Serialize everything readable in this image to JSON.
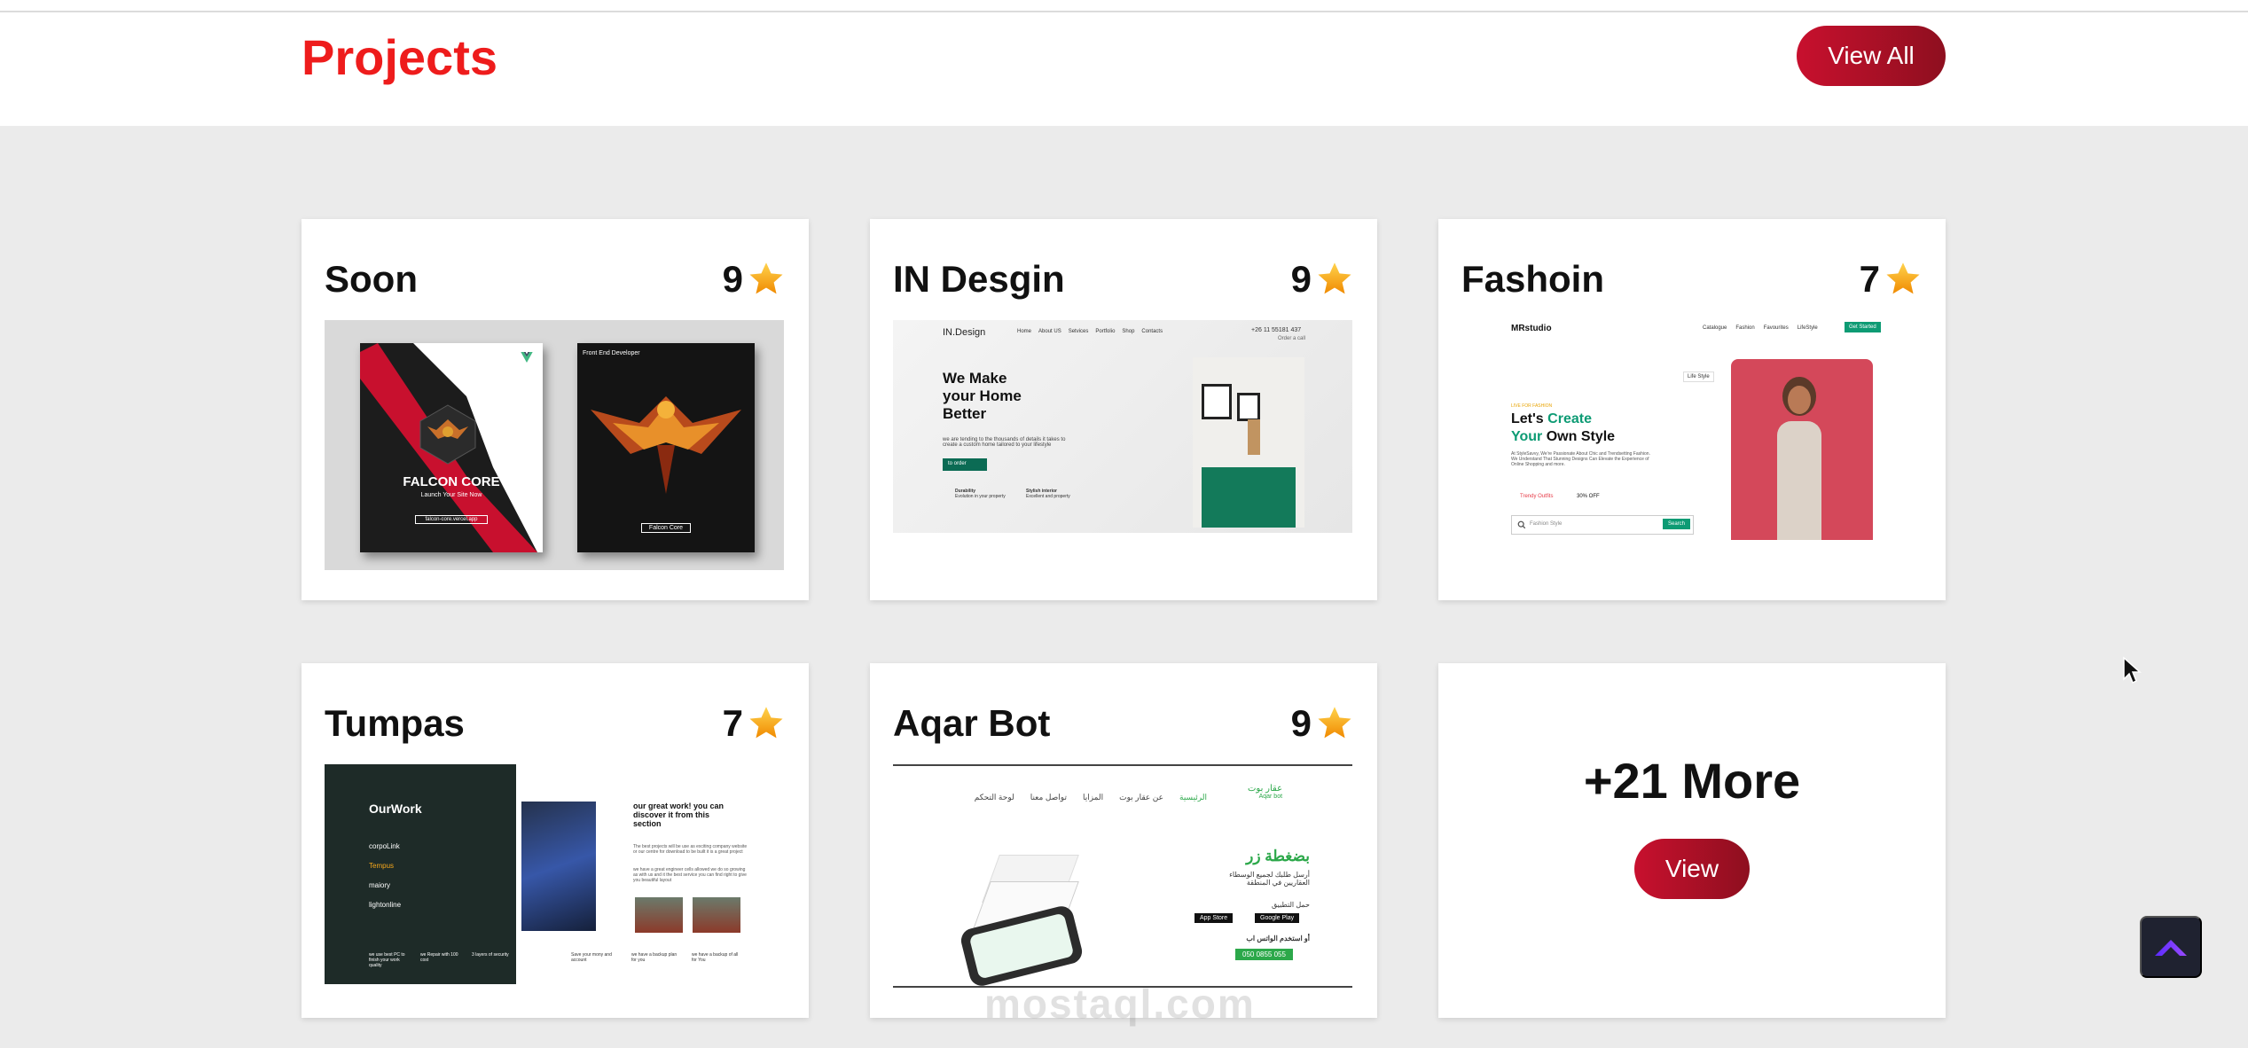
{
  "header": {
    "title": "Projects",
    "view_all_label": "View All"
  },
  "projects": [
    {
      "title": "Soon",
      "rating": "9",
      "thumb": {
        "book1_title": "FALCON CORE",
        "book1_subtitle": "Launch Your Site Now",
        "book1_footer": "falcon-core.vercel.app",
        "book2_header": "Front End Developer",
        "book2_footer": "Falcon Core"
      }
    },
    {
      "title": "IN Desgin",
      "rating": "9",
      "thumb": {
        "logo": "IN.Design",
        "nav": [
          "Home",
          "About US",
          "Setvices",
          "Portfolio",
          "Shop",
          "Contacts"
        ],
        "phone": "+26 11 55181 437",
        "phone_sub": "Order a call",
        "headline_1": "We Make",
        "headline_2": "your Home",
        "headline_3": "Better",
        "body": "we are tending to the thousands of details it takes to create a custom home tailored to your lifestyle",
        "cta": "to order",
        "feature1_title": "Durability",
        "feature1_text": "Evolution in your property",
        "feature2_title": "Stylish interior",
        "feature2_text": "Excellent and property"
      }
    },
    {
      "title": "Fashoin",
      "rating": "7",
      "thumb": {
        "logo": "MRstudio",
        "nav": [
          "Catalogue",
          "Fashion",
          "Favourites",
          "LifeStyle"
        ],
        "nav_cta": "Get Started",
        "eyebrow": "LIVE FOR FASHION",
        "headline_1_pre": "Let's ",
        "headline_1_accent": "Create",
        "headline_2_accent": "Your",
        "headline_2_post": " Own Style",
        "body": "At StyleSavvy, We're Passionate About Chic and Trendsetting Fashion. We Understand That Stunning Designs Can Elevate the Experience of Online Shopping and more.",
        "tag1": "Trendy Outfits",
        "tag2": "30% OFF",
        "search_placeholder": "Fashion Style",
        "search_button": "Search",
        "badge": "Life Style"
      }
    },
    {
      "title": "Tumpas",
      "rating": "7",
      "thumb": {
        "panel_title": "OurWork",
        "list": [
          "corpoLink",
          "Tempus",
          "maiory",
          "lightonline"
        ],
        "heading": "our great work! you can discover it from this section",
        "body": "The best projects will be use as exciting company website or our centre for download to be built it is a great project",
        "body2": "we have a great engineer cells allowed we do so growing as with us and it the best service you can find right to give you beautiful layout",
        "features": [
          "we use best PC to finish your work quality",
          "we Repair with 100 cost",
          "3 layers of security",
          "Save your mony and account",
          "we have a backup plan for you",
          "we have a backup of all for You"
        ]
      }
    },
    {
      "title": "Aqar Bot",
      "rating": "9",
      "thumb": {
        "brand": "عقار بوت",
        "brand_en": "Aqar bot",
        "nav": [
          "الرئيسية",
          "عن عقار بوت",
          "المزايا",
          "تواصل معنا",
          "لوحة التحكم"
        ],
        "headline": "بضغطة زر",
        "body": "أرسل طلبك لجميع الوسطاء العقاريين في المنطقة",
        "download": "حمل التطبيق",
        "app_store": "App Store",
        "google_play": "Google Play",
        "whatsapp": "أو استخدم الواتس اب",
        "phone": "050 0855 055"
      }
    }
  ],
  "more_card": {
    "title": "+21 More",
    "button_label": "View"
  },
  "watermark": "mostaql.com",
  "colors": {
    "accent_red": "#ee1c1c",
    "button_gradient_start": "#c8102e",
    "button_gradient_end": "#8e0f1f",
    "star": "#f7a81b",
    "scroll_button_bg": "#1f2230",
    "scroll_arrow": "#7b3cff"
  },
  "icons": [
    "star-icon",
    "chevron-up-icon",
    "cursor-icon",
    "search-icon",
    "heart-icon",
    "cart-icon"
  ]
}
